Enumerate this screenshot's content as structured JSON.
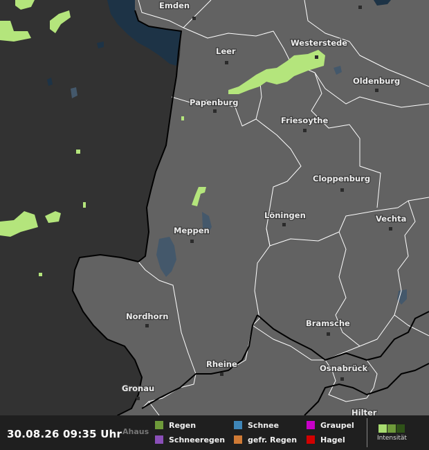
{
  "map": {
    "cities": [
      {
        "name": "Emden"
      },
      {
        "name": "Leer"
      },
      {
        "name": "Westerstede"
      },
      {
        "name": "Oldenburg"
      },
      {
        "name": "Papenburg"
      },
      {
        "name": "Friesoythe"
      },
      {
        "name": "Cloppenburg"
      },
      {
        "name": "Meppen"
      },
      {
        "name": "Löningen"
      },
      {
        "name": "Vechta"
      },
      {
        "name": "Nordhorn"
      },
      {
        "name": "Bramsche"
      },
      {
        "name": "Rheine"
      },
      {
        "name": "Osnabrück"
      },
      {
        "name": "Gronau"
      },
      {
        "name": "Hilter"
      },
      {
        "name": "Ahaus"
      }
    ],
    "colors": {
      "land": "#626262",
      "outside": "#323232",
      "water": "#1d3346",
      "rain": "#b4e57c",
      "border": "#000000",
      "district_line": "#ffffff"
    }
  },
  "legend": {
    "timestamp": "30.08.26 09:35 Uhr",
    "items": [
      {
        "label": "Regen",
        "color": "#6e9a3a",
        "icon": "rain-swatch"
      },
      {
        "label": "Schneeregen",
        "color": "#8a4fb8",
        "icon": "sleet-swatch"
      },
      {
        "label": "Schnee",
        "color": "#3f86b8",
        "icon": "snow-swatch"
      },
      {
        "label": "gefr. Regen",
        "color": "#cf7a35",
        "icon": "freezing-rain-swatch"
      },
      {
        "label": "Graupel",
        "color": "#c800c8",
        "icon": "graupel-swatch"
      },
      {
        "label": "Hagel",
        "color": "#d20000",
        "icon": "hail-swatch"
      }
    ],
    "intensity_label": "Intensität",
    "intensity_colors": [
      "#a8dc70",
      "#6e9a3a",
      "#2f5218"
    ]
  }
}
